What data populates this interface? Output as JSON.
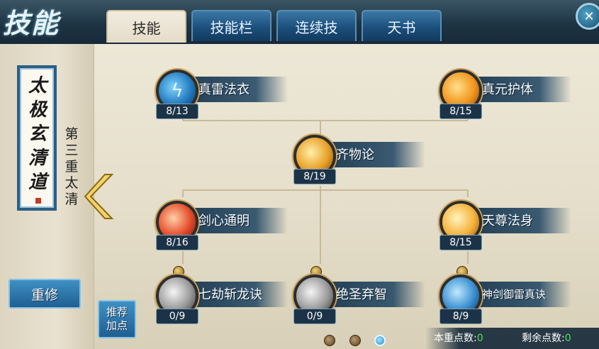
{
  "header": {
    "title": "技能",
    "tabs": [
      {
        "label": "技能",
        "active": true
      },
      {
        "label": "技能栏",
        "active": false
      },
      {
        "label": "连续技",
        "active": false
      },
      {
        "label": "天书",
        "active": false
      }
    ],
    "close_icon": "close-icon"
  },
  "sidebar": {
    "scroll_title": "太极玄清道",
    "stage_label": "第三重太清",
    "reset_label": "重修",
    "recommend_label_line1": "推荐",
    "recommend_label_line2": "加点"
  },
  "skills": [
    {
      "name": "真雷法衣",
      "level": "8/13",
      "icon": "lightning-icon"
    },
    {
      "name": "真元护体",
      "level": "8/15",
      "icon": "golden-shield-icon"
    },
    {
      "name": "齐物论",
      "level": "8/19",
      "icon": "golden-scroll-icon"
    },
    {
      "name": "剑心通明",
      "level": "8/16",
      "icon": "red-sword-icon"
    },
    {
      "name": "天尊法身",
      "level": "8/15",
      "icon": "flame-burst-icon"
    },
    {
      "name": "七劫斩龙诀",
      "level": "0/9",
      "icon": "white-sword-icon"
    },
    {
      "name": "绝圣弃智",
      "level": "0/9",
      "icon": "grey-blade-icon"
    },
    {
      "name": "神剑御雷真诀",
      "level": "8/9",
      "icon": "storm-icon"
    }
  ],
  "footer": {
    "page_dots": 3,
    "active_page": 3,
    "stat_label_1": "本重点数:",
    "stat_value_1": "0",
    "stat_label_2": "剩余点数:",
    "stat_value_2": "0"
  },
  "colors": {
    "tab_blue": "#1c4f7c",
    "parchment": "#e6dfcb",
    "accent_gold": "#c9a35a",
    "stat_green": "#4fe05a"
  }
}
